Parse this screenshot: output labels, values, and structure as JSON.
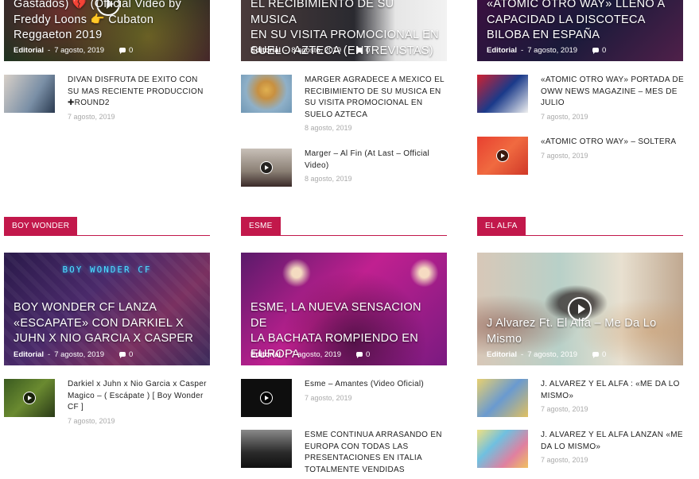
{
  "top": {
    "col1": {
      "hero": {
        "title_lines": [
          "Gastados) 💔 (Official Video by",
          "Freddy Loons 👉 Cubaton",
          "Reggaeton 2019"
        ],
        "author": "Editorial",
        "date": "7 agosto, 2019",
        "comments": "0"
      },
      "items": [
        {
          "title": "DIVAN DISFRUTA DE EXITO CON SU MAS RECIENTE PRODUCCION ✚ROUND2",
          "date": "7 agosto, 2019"
        }
      ]
    },
    "col2": {
      "hero": {
        "title_lines": [
          "EL RECIBIMIENTO DE SU MUSICA",
          "EN SU VISITA PROMOCIONAL EN",
          "SUELO AZTECA (ENTREVISTAS)"
        ],
        "author": "Editorial",
        "date": "8 agosto, 2019",
        "comments": "0"
      },
      "items": [
        {
          "title": "MARGER AGRADECE A MEXICO EL RECIBIMIENTO DE SU MUSICA EN SU VISITA PROMOCIONAL EN SUELO AZTECA",
          "date": "8 agosto, 2019"
        },
        {
          "title": "Marger – Al Fin (At Last – Official Video)",
          "date": "8 agosto, 2019"
        }
      ]
    },
    "col3": {
      "hero": {
        "title_lines": [
          "«ATOMIC OTRO WAY» LLENO A",
          "CAPACIDAD LA DISCOTECA",
          "BILOBA EN ESPAÑA"
        ],
        "author": "Editorial",
        "date": "7 agosto, 2019",
        "comments": "0"
      },
      "items": [
        {
          "title": "«ATOMIC OTRO WAY» PORTADA DE OWW NEWS MAGAZINE – MES DE JULIO",
          "date": "7 agosto, 2019"
        },
        {
          "title": "«ATOMIC OTRO WAY» – SOLTERA",
          "date": "7 agosto, 2019"
        }
      ]
    }
  },
  "bottom": {
    "col1": {
      "section": "BOY WONDER",
      "hero": {
        "overlay_text": "BOY WONDER CF",
        "title_lines": [
          "BOY WONDER CF LANZA",
          "«ESCAPATE» CON DARKIEL X",
          "JUHN X NIO GARCIA X CASPER"
        ],
        "author": "Editorial",
        "date": "7 agosto, 2019",
        "comments": "0"
      },
      "items": [
        {
          "title": "Darkiel x Juhn x Nio Garcia x Casper Magico – ( Escápate ) [ Boy Wonder CF ]",
          "date": "7 agosto, 2019"
        }
      ]
    },
    "col2": {
      "section": "ESME",
      "hero": {
        "title_lines": [
          "ESME, LA NUEVA SENSACION DE",
          "LA BACHATA ROMPIENDO EN",
          "EUROPA"
        ],
        "author": "Editorial",
        "date": "7 agosto, 2019",
        "comments": "0"
      },
      "items": [
        {
          "title": "Esme – Amantes (Video Oficial)",
          "date": "7 agosto, 2019"
        },
        {
          "title": "ESME CONTINUA ARRASANDO EN EUROPA CON TODAS LAS PRESENTACIONES EN ITALIA TOTALMENTE VENDIDAS",
          "date": ""
        }
      ]
    },
    "col3": {
      "section": "EL ALFA",
      "hero": {
        "title_lines": [
          "J Alvarez Ft. El Alfa – Me Da Lo",
          "Mismo"
        ],
        "author": "Editorial",
        "date": "7 agosto, 2019",
        "comments": "0"
      },
      "items": [
        {
          "title": "J. ALVAREZ Y EL ALFA : «ME DA LO MISMO»",
          "date": "7 agosto, 2019"
        },
        {
          "title": "J. ALVAREZ Y EL ALFA LANZAN «ME DA LO MISMO»",
          "date": "7 agosto, 2019"
        }
      ]
    }
  },
  "colors": {
    "accent": "#c2184b",
    "date_gray": "#aaaaaa",
    "text": "#222222"
  }
}
